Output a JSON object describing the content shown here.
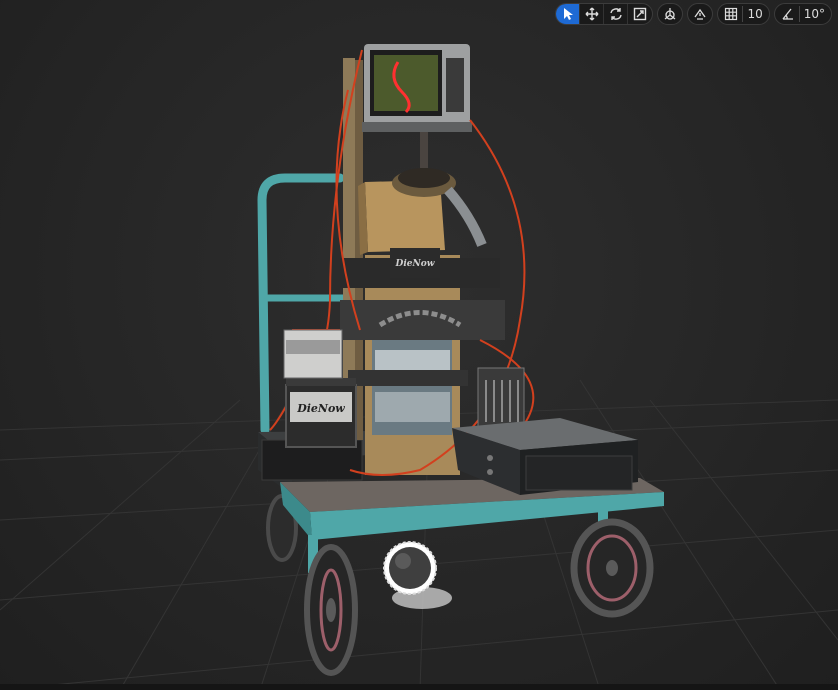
{
  "viewport": {
    "toolbar": {
      "select_icon": "cursor-arrow",
      "translate_icon": "move-arrows",
      "rotate_icon": "rotate-arrows",
      "scale_icon": "scale-box",
      "world_local_icon": "globe-axis",
      "surface_snap_icon": "surface-snap",
      "grid_snap_value": "10",
      "rotation_snap_value": "10°"
    },
    "model": {
      "battery_label_1": "DieNow",
      "battery_label_2": "DieNow"
    }
  },
  "colors": {
    "viewport_bg": "#262626",
    "active_tool": "#1e6ad4",
    "cart_frame": "#4fa7a8",
    "wire": "#d2401e",
    "wood": "#b8955e"
  }
}
